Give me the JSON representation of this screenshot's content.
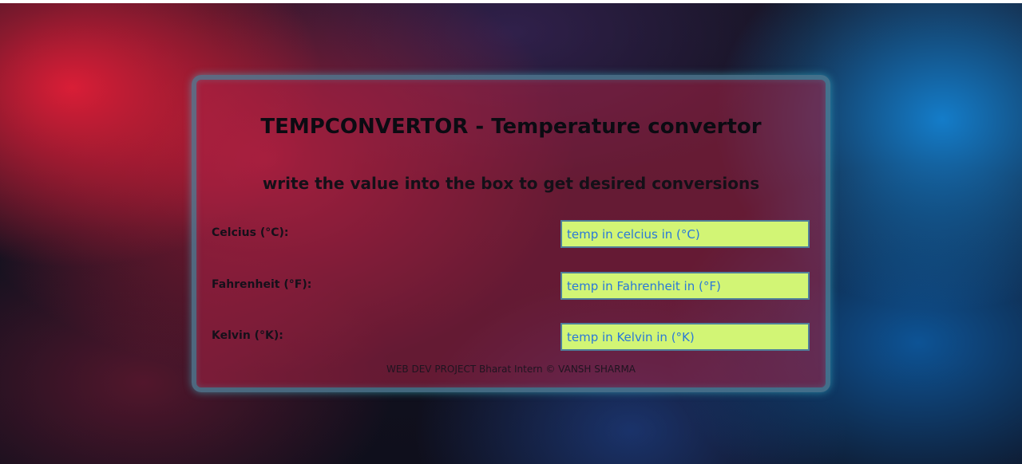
{
  "app": {
    "title": "TEMPCONVERTOR - Temperature convertor",
    "subtitle": "write the value into the box to get desired conversions"
  },
  "converter": {
    "celsius": {
      "label": "Celcius (°C):",
      "value": "",
      "placeholder": "temp in celcius in (°C)"
    },
    "fahrenheit": {
      "label": "Fahrenheit (°F):",
      "value": "",
      "placeholder": "temp in Fahrenheit in (°F)"
    },
    "kelvin": {
      "label": "Kelvin (°K):",
      "value": "",
      "placeholder": "temp in Kelvin in (°K)"
    }
  },
  "footer": {
    "text": "WEB DEV PROJECT Bharat Intern © VANSH SHARMA"
  },
  "colors": {
    "input_background": "#d2f575",
    "input_text": "#2a78d8",
    "card_border": "#26a8b9",
    "card_background": "#aa2346"
  }
}
